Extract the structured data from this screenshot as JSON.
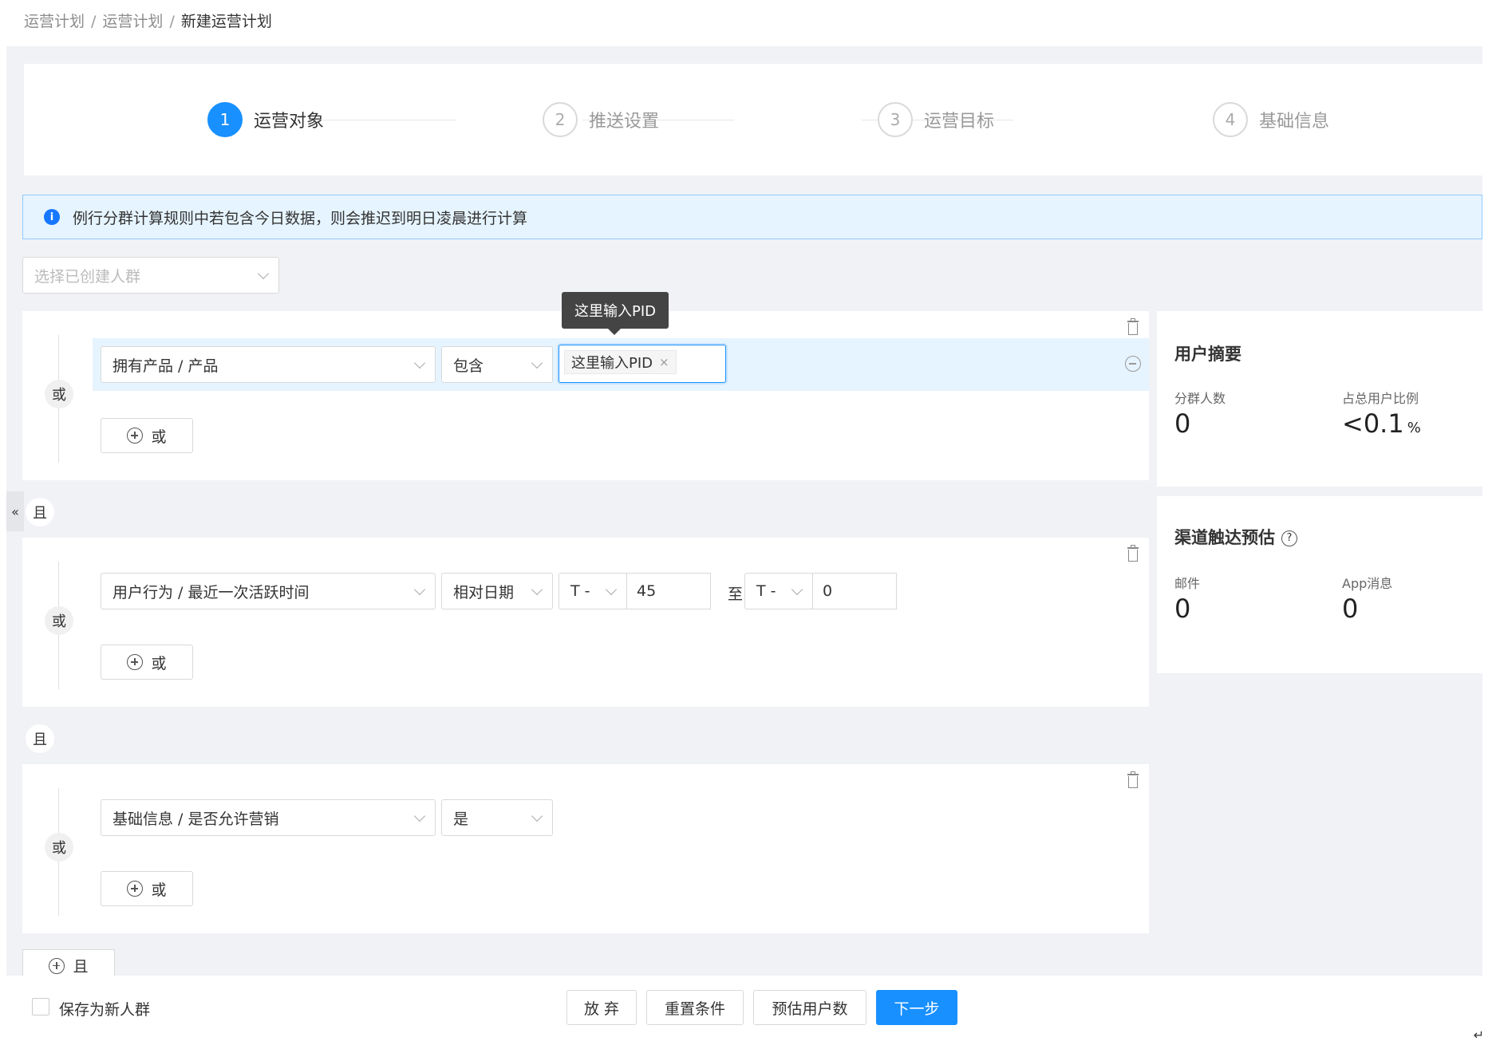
{
  "breadcrumb": [
    "运营计划",
    "运营计划",
    "新建运营计划"
  ],
  "breadcrumb_sep": "/",
  "steps": [
    {
      "num": "1",
      "label": "运营对象"
    },
    {
      "num": "2",
      "label": "推送设置"
    },
    {
      "num": "3",
      "label": "运营目标"
    },
    {
      "num": "4",
      "label": "基础信息"
    }
  ],
  "alert": {
    "icon": "info-icon",
    "text": "例行分群计算规则中若包含今日数据，则会推迟到明日凌晨进行计算"
  },
  "crowd_select": {
    "placeholder": "选择已创建人群"
  },
  "collapse_tab": "«",
  "or_label": "或",
  "and_label": "且",
  "add_or_label": "或",
  "add_and_label": "且",
  "tooltip": "这里输入PID",
  "conditions": [
    {
      "field": "拥有产品 / 产品",
      "operator": "包含",
      "tag": "这里输入PID",
      "tag_close": "×"
    },
    {
      "field": "用户行为 / 最近一次活跃时间",
      "operator": "相对日期",
      "from_prefix": "T -",
      "from_value": "45",
      "to_text": "至",
      "to_prefix": "T -",
      "to_value": "0"
    },
    {
      "field": "基础信息 / 是否允许营销",
      "operator": "是"
    }
  ],
  "summary": {
    "title": "用户摘要",
    "segment_count_label": "分群人数",
    "segment_count": "0",
    "ratio_label": "占总用户比例",
    "ratio": "<0.1",
    "ratio_unit": "%"
  },
  "channel": {
    "title": "渠道触达预估",
    "help": "?",
    "email_label": "邮件",
    "email_value": "0",
    "app_label": "App消息",
    "app_value": "0"
  },
  "footer": {
    "save_label": "保存为新人群",
    "buttons": {
      "discard": "放 弃",
      "reset": "重置条件",
      "estimate": "预估用户数",
      "next": "下一步"
    }
  },
  "enter_mark": "↵",
  "colors": {
    "primary": "#1890ff",
    "alert_bg": "#e6f4ff",
    "page_bg": "#f0f2f5"
  }
}
